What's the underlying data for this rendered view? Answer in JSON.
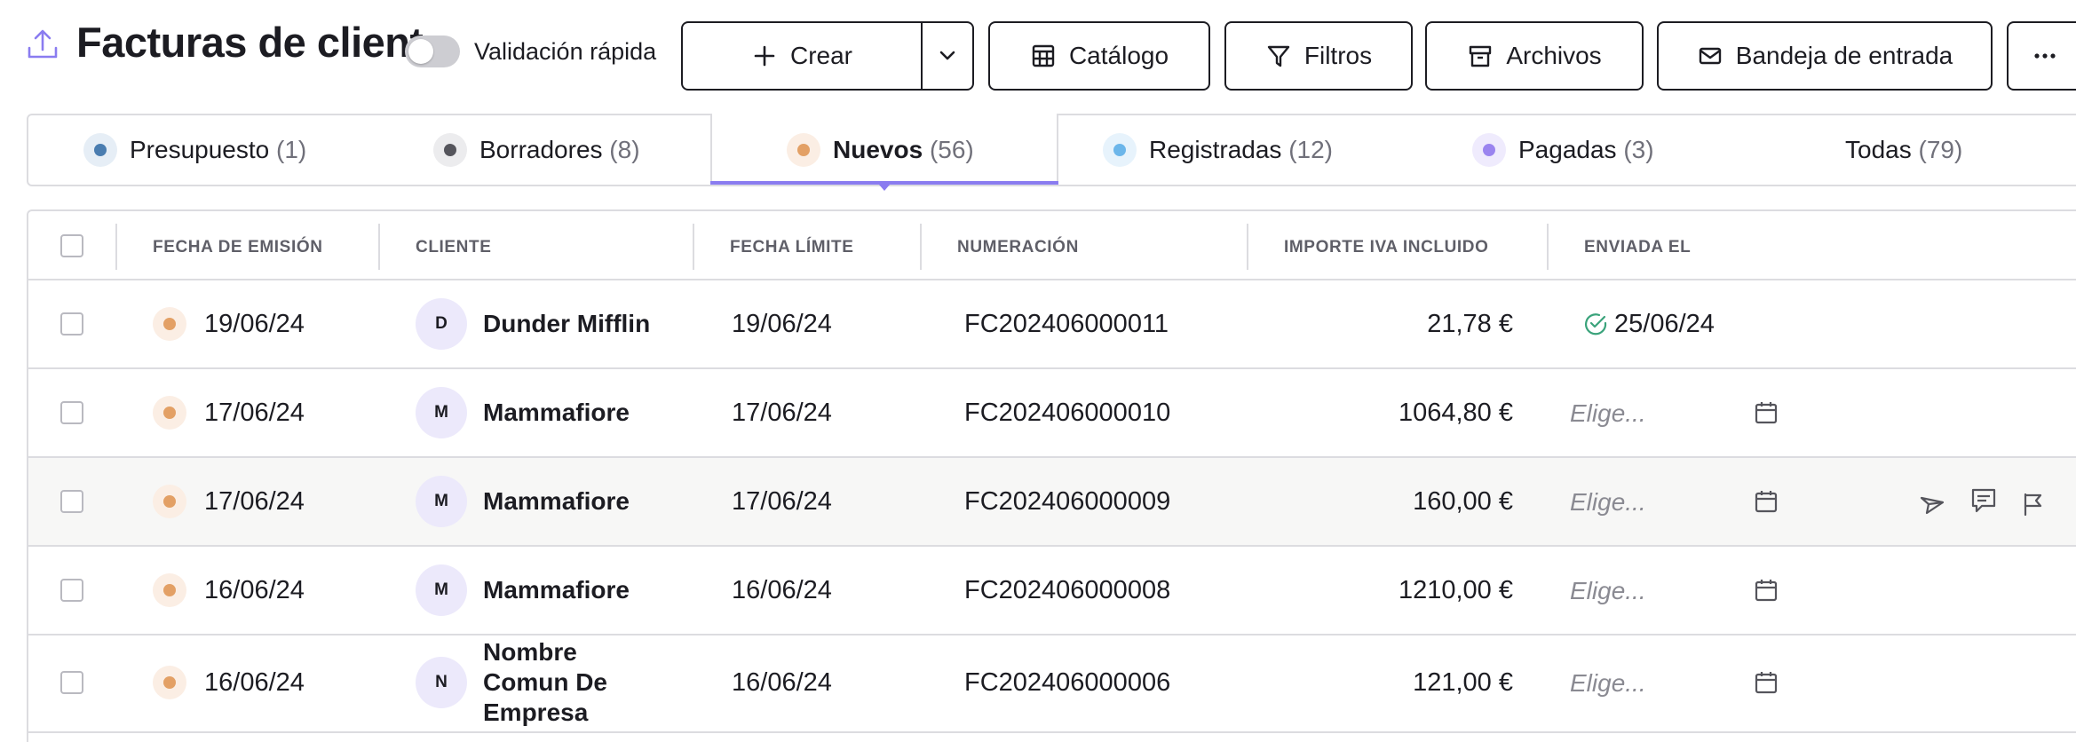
{
  "header": {
    "title": "Facturas de cliente",
    "quick_validation_label": "Validación rápida",
    "quick_validation_on": false,
    "buttons": {
      "create": "Crear",
      "catalog": "Catálogo",
      "filters": "Filtros",
      "archives": "Archivos",
      "inbox": "Bandeja de entrada"
    }
  },
  "tabs": [
    {
      "label": "Presupuesto",
      "count": "(1)",
      "color": "#4a7db0",
      "bg": "#e6eef6"
    },
    {
      "label": "Borradores",
      "count": "(8)",
      "color": "#55555c",
      "bg": "#ececee"
    },
    {
      "label": "Nuevos",
      "count": "(56)",
      "color": "#e3a065",
      "bg": "#fbeee4",
      "active": true
    },
    {
      "label": "Registradas",
      "count": "(12)",
      "color": "#6cb6ea",
      "bg": "#e7f3fc"
    },
    {
      "label": "Pagadas",
      "count": "(3)",
      "color": "#9a84ef",
      "bg": "#efebfd"
    },
    {
      "label": "Todas",
      "count": "(79)"
    }
  ],
  "table": {
    "columns": [
      "FECHA DE EMISIÓN",
      "CLIENTE",
      "FECHA LÍMITE",
      "NUMERACIÓN",
      "IMPORTE IVA INCLUIDO",
      "ENVIADA EL"
    ],
    "rows": [
      {
        "issue_date": "19/06/24",
        "avatar": "D",
        "client": "Dunder Mifflin",
        "due_date": "19/06/24",
        "number": "FC202406000011",
        "amount": "21,78 €",
        "sent": "25/06/24"
      },
      {
        "issue_date": "17/06/24",
        "avatar": "M",
        "client": "Mammafiore",
        "due_date": "17/06/24",
        "number": "FC202406000010",
        "amount": "1064,80 €",
        "sent_placeholder": "Elige..."
      },
      {
        "issue_date": "17/06/24",
        "avatar": "M",
        "client": "Mammafiore",
        "due_date": "17/06/24",
        "number": "FC202406000009",
        "amount": "160,00 €",
        "sent_placeholder": "Elige..."
      },
      {
        "issue_date": "16/06/24",
        "avatar": "M",
        "client": "Mammafiore",
        "due_date": "16/06/24",
        "number": "FC202406000008",
        "amount": "1210,00 €",
        "sent_placeholder": "Elige..."
      },
      {
        "issue_date": "16/06/24",
        "avatar": "N",
        "client_lines": [
          "Nombre",
          "Comun De",
          "Empresa"
        ],
        "due_date": "16/06/24",
        "number": "FC202406000006",
        "amount": "121,00 €",
        "sent_placeholder": "Elige..."
      }
    ]
  },
  "colors": {
    "accent": "#8a7cf0",
    "border": "#dcdce0",
    "status_new": "#e3a065",
    "sent_check": "#3aa37b"
  },
  "icons": [
    "upload-icon",
    "plus-icon",
    "chevron-down-icon",
    "catalog-icon",
    "filter-icon",
    "archive-icon",
    "mail-icon",
    "more-icon",
    "check-circle-icon",
    "calendar-icon",
    "send-icon",
    "comment-icon",
    "flag-icon"
  ]
}
